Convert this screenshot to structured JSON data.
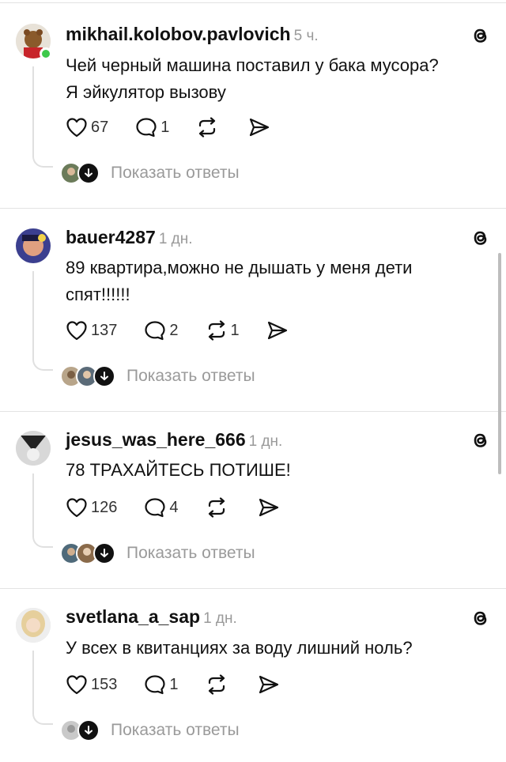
{
  "comments": [
    {
      "username": "mikhail.kolobov.pavlovich",
      "time": "5 ч.",
      "text_line1": "Чей черный машина поставил у бака мусора?",
      "text_line2": "Я эйкулятор вызову",
      "likes": "67",
      "replies": "1",
      "reposts": "",
      "show_replies": "Показать ответы",
      "online": true
    },
    {
      "username": "bauer4287",
      "time": "1 дн.",
      "text_line1": "89 квартира,можно не дышать у меня дети",
      "text_line2": "спят!!!!!!",
      "likes": "137",
      "replies": "2",
      "reposts": "1",
      "show_replies": "Показать ответы"
    },
    {
      "username": "jesus_was_here_666",
      "time": "1 дн.",
      "text_line1": "78 ТРАХАЙТЕСЬ ПОТИШЕ!",
      "text_line2": "",
      "likes": "126",
      "replies": "4",
      "reposts": "",
      "show_replies": "Показать ответы"
    },
    {
      "username": "svetlana_a_sap",
      "time": "1 дн.",
      "text_line1": "У всех в квитанциях за воду лишний ноль?",
      "text_line2": "",
      "likes": "153",
      "replies": "1",
      "reposts": "",
      "show_replies": "Показать ответы"
    }
  ],
  "icons": {
    "like": "heart-icon",
    "reply": "speech-bubble-icon",
    "repost": "repost-icon",
    "share": "send-icon",
    "logo": "threads-logo-icon"
  },
  "colors": {
    "online": "#3ec94a",
    "muted": "#9a9a9a"
  }
}
